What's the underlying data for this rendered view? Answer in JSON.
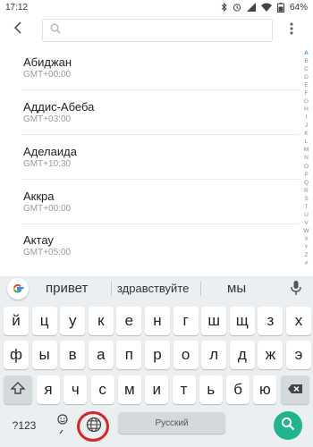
{
  "status_bar": {
    "time": "17:12",
    "battery": "64%"
  },
  "toolbar": {
    "search_placeholder": ""
  },
  "cities": [
    {
      "name": "Абиджан",
      "tz": "GMT+00:00"
    },
    {
      "name": "Аддис-Абеба",
      "tz": "GMT+03:00"
    },
    {
      "name": "Аделаида",
      "tz": "GMT+10:30"
    },
    {
      "name": "Аккра",
      "tz": "GMT+00:00"
    },
    {
      "name": "Актау",
      "tz": "GMT+05:00"
    }
  ],
  "alphabet_index": [
    "A",
    "B",
    "C",
    "D",
    "E",
    "F",
    "G",
    "H",
    "I",
    "J",
    "K",
    "L",
    "M",
    "N",
    "O",
    "P",
    "Q",
    "R",
    "S",
    "T",
    "U",
    "V",
    "W",
    "X",
    "Y",
    "Z",
    "#"
  ],
  "alphabet_active": "A",
  "keyboard": {
    "suggestions": [
      "привет",
      "здравствуйте",
      "мы"
    ],
    "row1": [
      "й",
      "ц",
      "у",
      "к",
      "е",
      "н",
      "г",
      "ш",
      "щ",
      "з",
      "х"
    ],
    "row2": [
      "ф",
      "ы",
      "в",
      "а",
      "п",
      "р",
      "о",
      "л",
      "д",
      "ж",
      "э"
    ],
    "row3": [
      "я",
      "ч",
      "с",
      "м",
      "и",
      "т",
      "ь",
      "б",
      "ю"
    ],
    "symbols_label": "?123",
    "space_label": "Русский",
    "accent_color": "#1eb58f",
    "highlight_color": "#d9231f"
  }
}
